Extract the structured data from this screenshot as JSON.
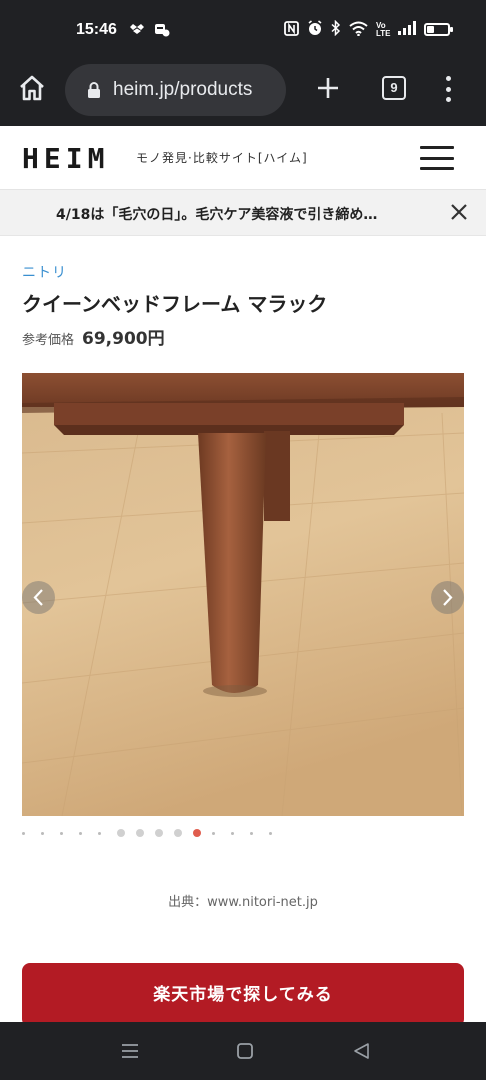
{
  "status_bar": {
    "time": "15:46",
    "battery_level": 0.35,
    "icons": [
      "dropbox-icon",
      "app-notification-icon",
      "nfc-icon",
      "alarm-icon",
      "bluetooth-icon",
      "wifi-icon",
      "volte-icon",
      "signal-icon",
      "battery-icon"
    ],
    "volte_label": "Vo LTE"
  },
  "browser": {
    "url": "heim.jp/products",
    "tab_count": "9"
  },
  "site": {
    "logo": "HEIM",
    "tagline": "モノ発見·比較サイト[ハイム]"
  },
  "announcement": {
    "text": "4/18は「毛穴の日」。毛穴ケア美容液で引き締め…"
  },
  "product": {
    "brand": "ニトリ",
    "title": "クイーンベッドフレーム マラック",
    "price_label": "参考価格",
    "price": "69,900円",
    "image_description_icon": "bed-leg-photo"
  },
  "carousel": {
    "total_slides": 14,
    "active_index": 9,
    "source": "出典：www.nitori-net.jp"
  },
  "cta": {
    "label": "楽天市場で探してみる"
  },
  "colors": {
    "status_bg": "#202124",
    "brand_link": "#3a8fd0",
    "cta": "#b31b24",
    "active_dot": "#e05d4e"
  }
}
